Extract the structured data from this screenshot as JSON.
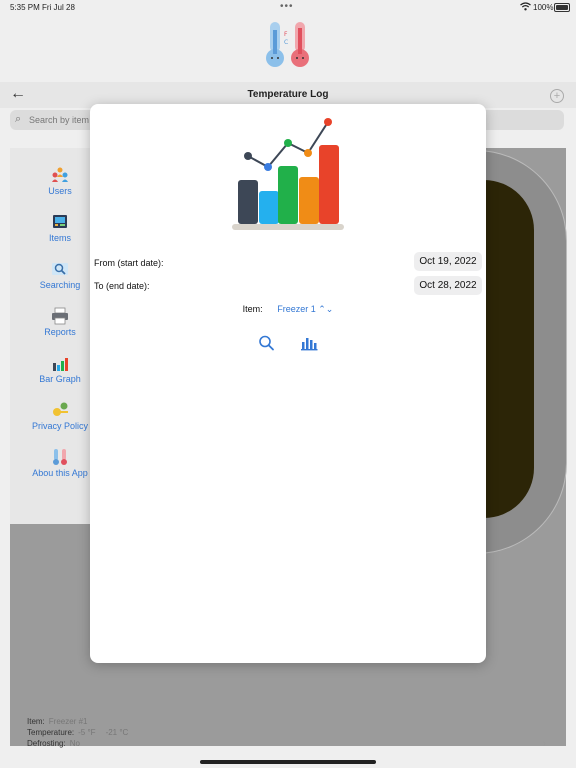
{
  "status_bar": {
    "time": "5:35 PM",
    "date": "Fri Jul 28",
    "battery": "100%"
  },
  "nav": {
    "title": "Temperature Log"
  },
  "search": {
    "placeholder": "Search by item"
  },
  "sidebar": {
    "items": [
      {
        "label": "Users",
        "icon": "users-icon"
      },
      {
        "label": "Items",
        "icon": "items-icon"
      },
      {
        "label": "Searching",
        "icon": "searching-icon"
      },
      {
        "label": "Reports",
        "icon": "printer-icon"
      },
      {
        "label": "Bar Graph",
        "icon": "bar-graph-icon"
      },
      {
        "label": "Privacy Policy",
        "icon": "privacy-icon"
      },
      {
        "label": "Abou this App",
        "icon": "thermometer-icon"
      }
    ]
  },
  "background_record": {
    "item_label": "Item:",
    "item_value": "Freezer #1",
    "temperature_label": "Temperature:",
    "temperature_f": "-5 °F",
    "temperature_c": "-21 °C",
    "defrosting_label": "Defrosting:",
    "defrosting_value": "No"
  },
  "modal": {
    "from_label": "From (start date):",
    "from_value": "Oct 19, 2022",
    "to_label": "To (end date):",
    "to_value": "Oct 28, 2022",
    "item_label": "Item:",
    "item_value": "Freezer 1",
    "search_icon": "search-icon",
    "chart_icon": "bar-chart-icon"
  },
  "colors": {
    "accent": "#3478d4"
  }
}
